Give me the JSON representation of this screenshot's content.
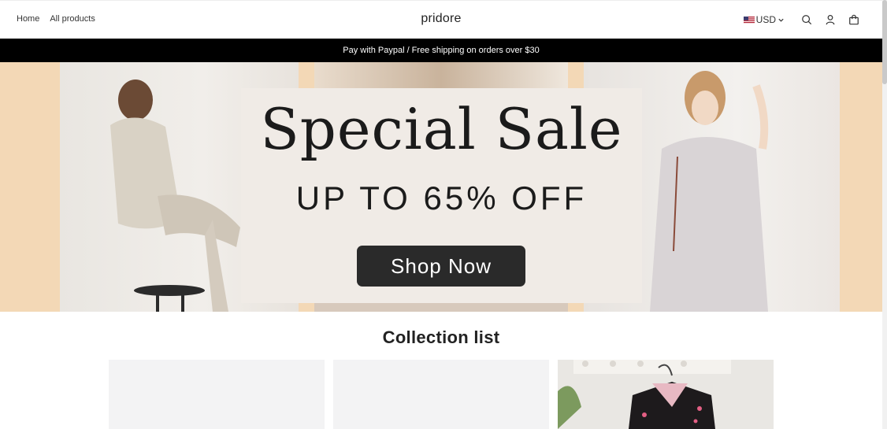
{
  "header": {
    "nav": [
      "Home",
      "All products"
    ],
    "logo": "pridore",
    "currency": "USD",
    "icons": [
      "us-flag-icon",
      "chevron-down-icon",
      "search-icon",
      "account-icon",
      "cart-icon"
    ]
  },
  "announcement": "Pay with Paypal / Free shipping on orders over $30",
  "hero": {
    "title": "Special Sale",
    "subtitle": "UP TO 65% OFF",
    "cta": "Shop Now"
  },
  "collection": {
    "title": "Collection list",
    "cards": 3
  },
  "colors": {
    "announcement_bg": "#000000",
    "hero_bg": "#f3d8b6",
    "cta_bg": "#2a2a2a",
    "card_bg": "#f3f3f4"
  }
}
